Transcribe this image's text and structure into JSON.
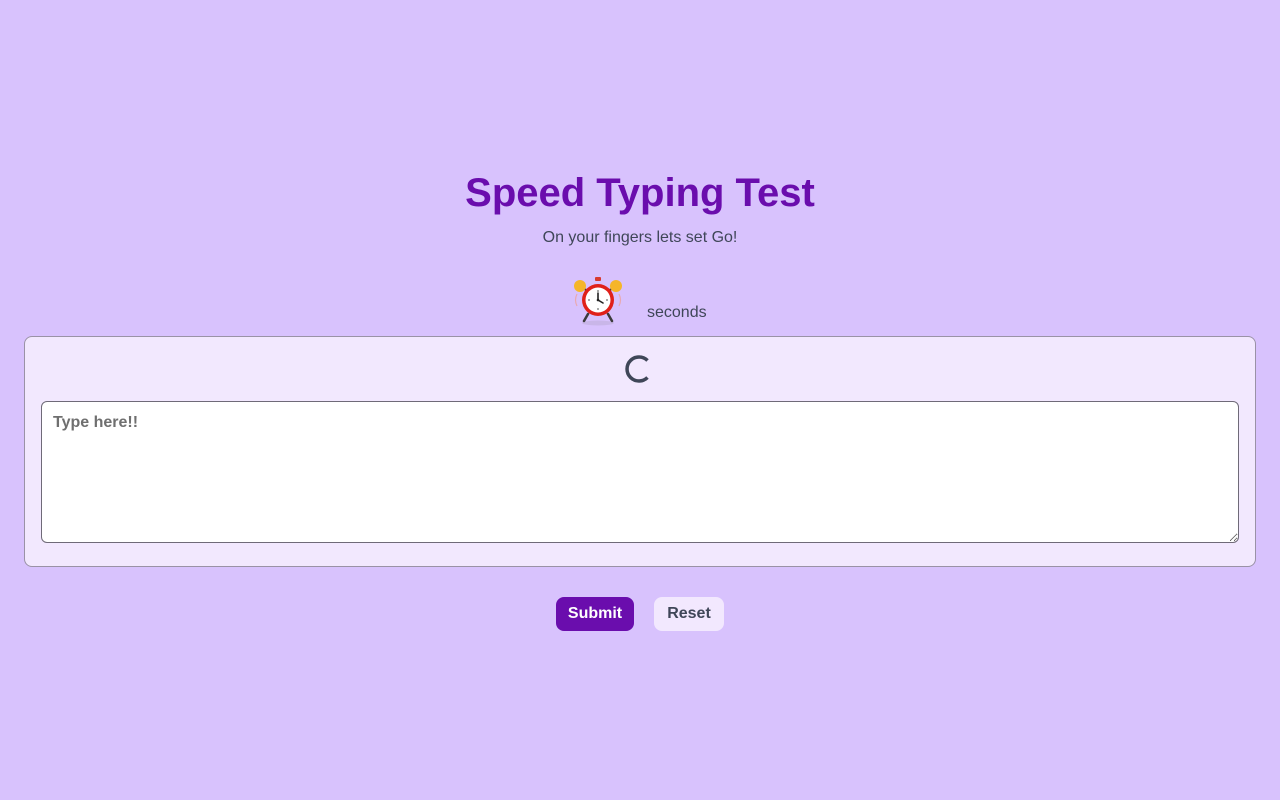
{
  "header": {
    "title": "Speed Typing Test",
    "subtitle": "On your fingers lets set Go!"
  },
  "timer": {
    "icon": "alarm-clock-icon",
    "value": "",
    "unit_label": "seconds"
  },
  "test_card": {
    "loading_icon": "spinner-icon",
    "quote_text": "",
    "input": {
      "value": "",
      "placeholder": "Type here!!"
    }
  },
  "actions": {
    "submit_label": "Submit",
    "reset_label": "Reset"
  },
  "colors": {
    "background": "#d8c2fd",
    "accent": "#6a0dad",
    "card": "#f2e8fe",
    "text": "#3f4658"
  }
}
